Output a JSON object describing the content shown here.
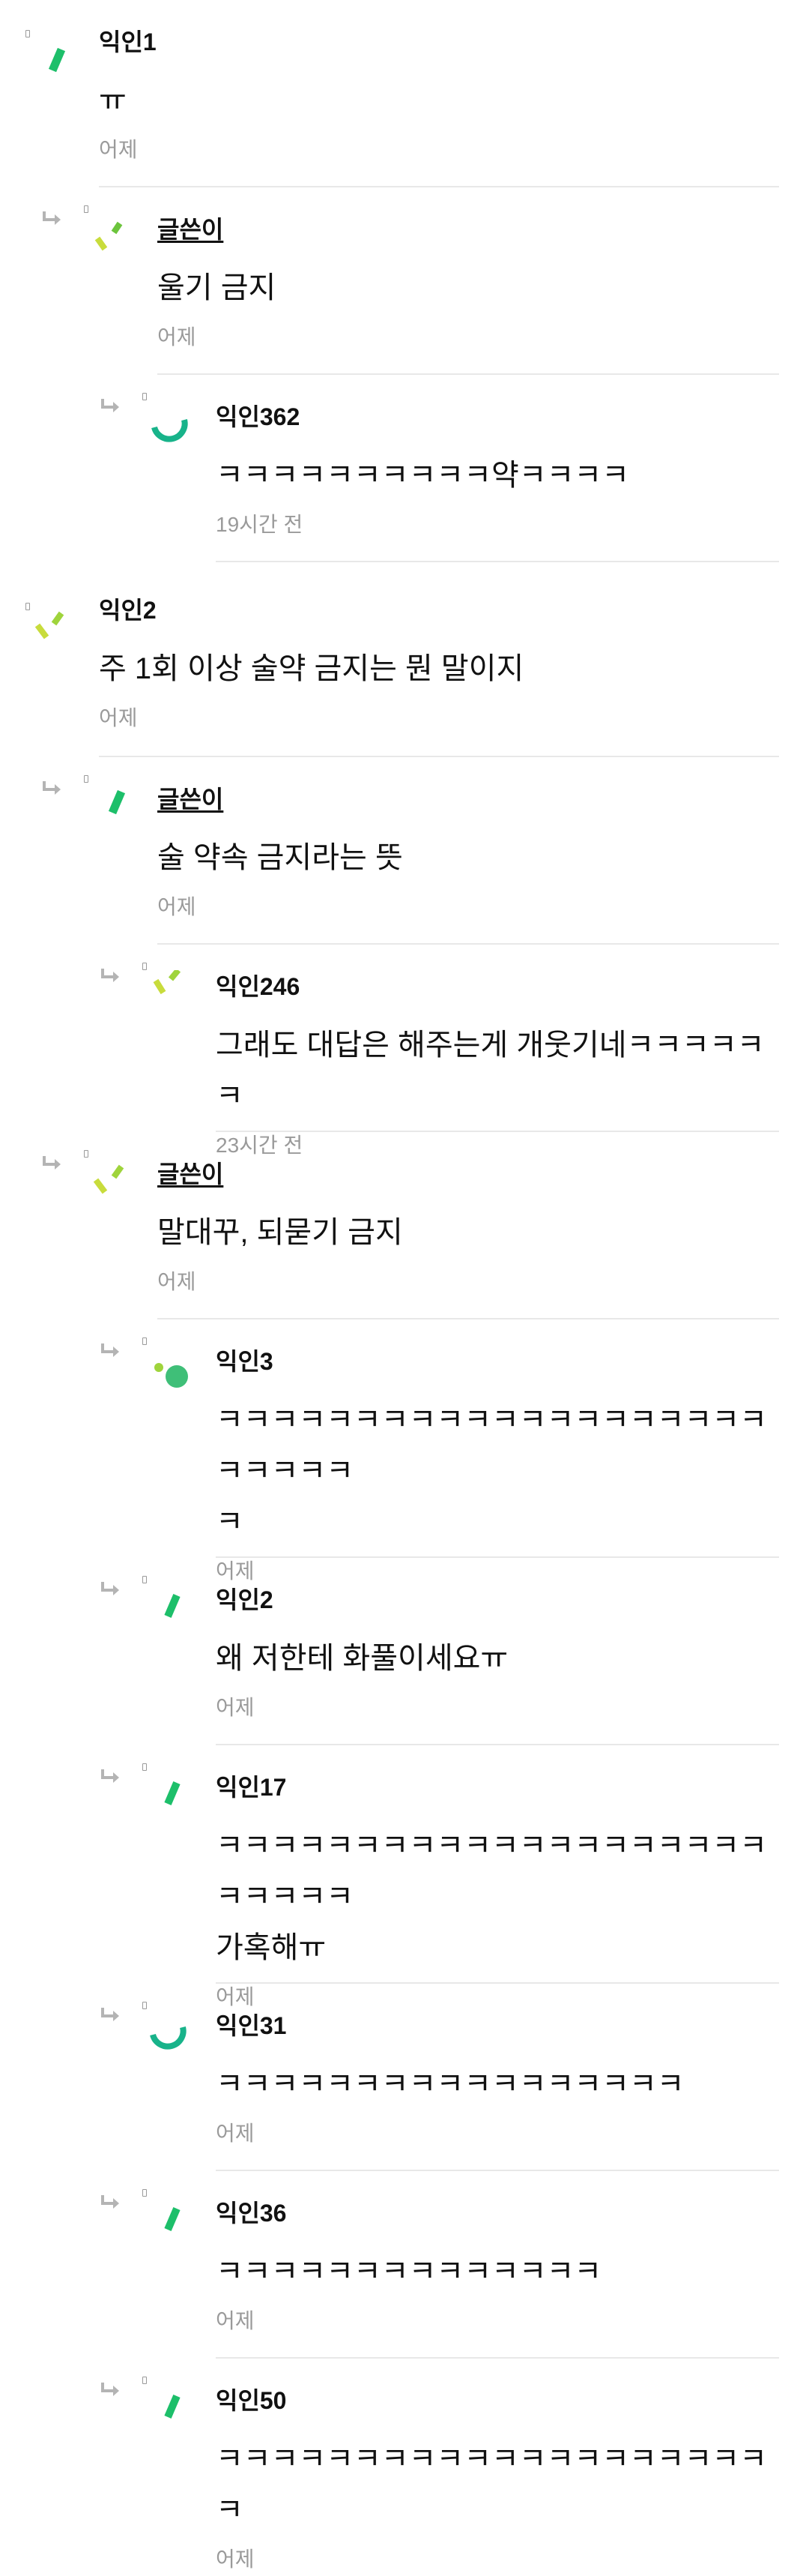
{
  "comments": [
    {
      "author": "익인1",
      "text": "ㅠ",
      "time": "어제",
      "writer": false,
      "avatar": "green-slash-icon"
    },
    {
      "author": "글쓴이",
      "text": "울기 금지",
      "time": "어제",
      "writer": true,
      "avatar": "lime-check-icon"
    },
    {
      "author": "익인362",
      "text": "ㅋㅋㅋㅋㅋㅋㅋㅋㅋㅋ약ㅋㅋㅋㅋ",
      "time": "19시간 전",
      "writer": false,
      "avatar": "teal-arc-icon"
    },
    {
      "author": "익인2",
      "text": "주 1회 이상 술약 금지는 뭔 말이지",
      "time": "어제",
      "writer": false,
      "avatar": "lime-check-icon"
    },
    {
      "author": "글쓴이",
      "text": "술 약속 금지라는 뜻",
      "time": "어제",
      "writer": true,
      "avatar": "green-slash-icon"
    },
    {
      "author": "익인246",
      "text": "그래도 대답은 해주는게 개웃기네ㅋㅋㅋㅋㅋㅋ",
      "time": "23시간 전",
      "writer": false,
      "avatar": "lime-check-icon"
    },
    {
      "author": "글쓴이",
      "text": "말대꾸, 되묻기 금지",
      "time": "어제",
      "writer": true,
      "avatar": "lime-check-icon"
    },
    {
      "author": "익인3",
      "text": "ㅋㅋㅋㅋㅋㅋㅋㅋㅋㅋㅋㅋㅋㅋㅋㅋㅋㅋㅋㅋㅋㅋㅋㅋㅋ\nㅋ",
      "time": "어제",
      "writer": false,
      "avatar": "green-dots-icon"
    },
    {
      "author": "익인2",
      "text": "왜 저한테 화풀이세요ㅠ",
      "time": "어제",
      "writer": false,
      "avatar": "green-slash-icon"
    },
    {
      "author": "익인17",
      "text": "ㅋㅋㅋㅋㅋㅋㅋㅋㅋㅋㅋㅋㅋㅋㅋㅋㅋㅋㅋㅋㅋㅋㅋㅋㅋ\n가혹해ㅠ",
      "time": "어제",
      "writer": false,
      "avatar": "green-slash-icon"
    },
    {
      "author": "익인31",
      "text": "ㅋㅋㅋㅋㅋㅋㅋㅋㅋㅋㅋㅋㅋㅋㅋㅋㅋ",
      "time": "어제",
      "writer": false,
      "avatar": "teal-arc-icon"
    },
    {
      "author": "익인36",
      "text": "ㅋㅋㅋㅋㅋㅋㅋㅋㅋㅋㅋㅋㅋㅋ",
      "time": "어제",
      "writer": false,
      "avatar": "green-slash-icon"
    },
    {
      "author": "익인50",
      "text": "ㅋㅋㅋㅋㅋㅋㅋㅋㅋㅋㅋㅋㅋㅋㅋㅋㅋㅋㅋㅋㅋ",
      "time": "어제",
      "writer": false,
      "avatar": "green-slash-icon"
    }
  ],
  "colors": {
    "green": "#1dbf6a",
    "lime": "#c8dc3c",
    "teal": "#18b38a",
    "dot_green": "#3fbf78",
    "muted": "#9a9a9a",
    "divider": "#e8e8e8"
  }
}
